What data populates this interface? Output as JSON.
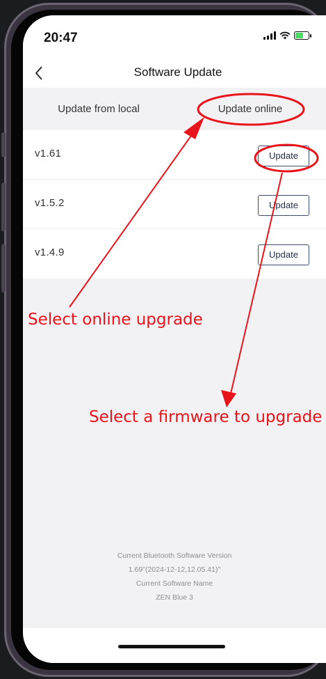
{
  "status_bar": {
    "time": "20:47"
  },
  "nav": {
    "back_glyph": "‹",
    "title": "Software Update"
  },
  "tabs": [
    {
      "label": "Update from local"
    },
    {
      "label": "Update online"
    }
  ],
  "versions": [
    {
      "label": "v1.61",
      "button": "Update"
    },
    {
      "label": "v1.5.2",
      "button": "Update"
    },
    {
      "label": "v1.4.9",
      "button": "Update"
    }
  ],
  "footer": {
    "line1": "Current Bluetooth Software Version",
    "line2": "1.69\"(2024-12-12,12.05.41)\"",
    "line3": "Current Software Name",
    "line4": "ZEN Blue 3"
  },
  "annotations": {
    "online": "Select online upgrade",
    "firmware": "Select a firmware to upgrade",
    "color": "#e8141b"
  },
  "icons": [
    "back-chevron-icon",
    "signal-icon",
    "wifi-icon",
    "battery-charging-icon"
  ]
}
